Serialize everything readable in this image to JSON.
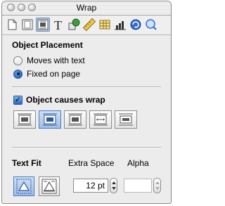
{
  "window": {
    "title": "Wrap"
  },
  "toolbar": {
    "icons": [
      "document-icon",
      "page-icon",
      "wrap-icon",
      "text-icon",
      "shape-icon",
      "ruler-icon",
      "table-icon",
      "chart-icon",
      "links-icon",
      "inspector-icon"
    ],
    "active": "wrap-icon"
  },
  "placement": {
    "heading": "Object Placement",
    "options": [
      {
        "label": "Moves with text",
        "selected": false
      },
      {
        "label": "Fixed on page",
        "selected": true
      }
    ]
  },
  "wrap": {
    "checkbox_label": "Object causes wrap",
    "checked": true,
    "styles": [
      "wrap-left-icon",
      "wrap-around-icon",
      "wrap-right-icon",
      "wrap-both-sides-icon",
      "wrap-above-below-icon"
    ],
    "selected_style": "wrap-around-icon"
  },
  "text_fit": {
    "heading": "Text Fit",
    "options": [
      "fit-shape-icon",
      "fit-box-icon"
    ],
    "selected": "fit-shape-icon"
  },
  "extra_space": {
    "label": "Extra Space",
    "value": "12 pt"
  },
  "alpha": {
    "label": "Alpha",
    "value": ""
  },
  "colors": {
    "accent": "#4f7bbd",
    "selected_fill": "#b8cbe6"
  }
}
